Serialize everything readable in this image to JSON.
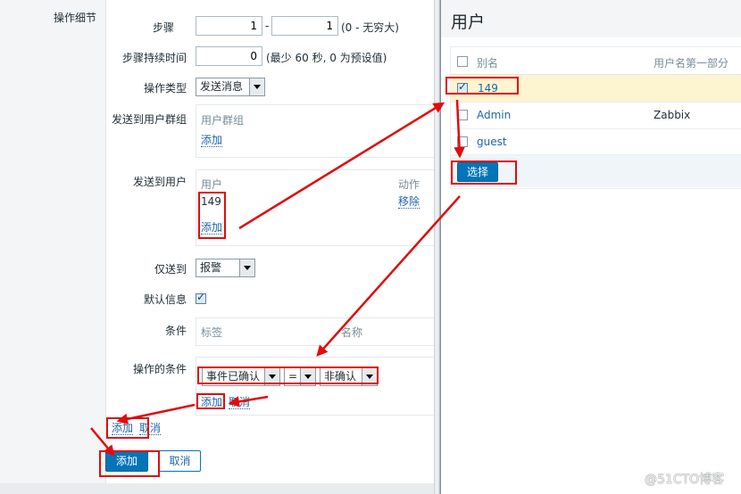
{
  "form": {
    "section_label": "操作细节",
    "step_label": "步骤",
    "step_from": "1",
    "step_dash": "-",
    "step_to": "1",
    "step_note": "(0 - 无穷大)",
    "duration_label": "步骤持续时间",
    "duration_value": "0",
    "duration_note": "(最少 60 秒, 0 为预设值)",
    "optype_label": "操作类型",
    "optype_value": "发送消息",
    "group_label": "发送到用户群组",
    "group_col": "用户群组",
    "group_add": "添加",
    "user_label": "发送到用户",
    "user_col": "用户",
    "user_action_col": "动作",
    "user_value": "149",
    "user_remove": "移除",
    "user_add": "添加",
    "sendonly_label": "仅送到",
    "sendonly_value": "报警",
    "default_msg_label": "默认信息",
    "default_msg_checked": true,
    "condition_label": "条件",
    "condition_col_tag": "标签",
    "condition_col_name": "名称",
    "opcond_label": "操作的条件",
    "opcond_field": "事件已确认",
    "opcond_operator": "=",
    "opcond_value": "非确认",
    "opcond_add": "添加",
    "opcond_cancel": "取消",
    "op_add": "添加",
    "op_cancel": "取消",
    "btn_add": "添加",
    "btn_cancel": "取消"
  },
  "popup": {
    "title": "用户",
    "col_alias": "别名",
    "col_name": "用户名第一部分",
    "rows": [
      {
        "alias": "149",
        "name": "",
        "checked": true
      },
      {
        "alias": "Admin",
        "name": "Zabbix",
        "checked": false
      },
      {
        "alias": "guest",
        "name": "",
        "checked": false
      }
    ],
    "select_button": "选择"
  },
  "watermark": "@51CTO博客",
  "colors": {
    "accent": "#0275b8",
    "annotation": "#e10c0c",
    "highlight_row": "#fdf4d0"
  }
}
